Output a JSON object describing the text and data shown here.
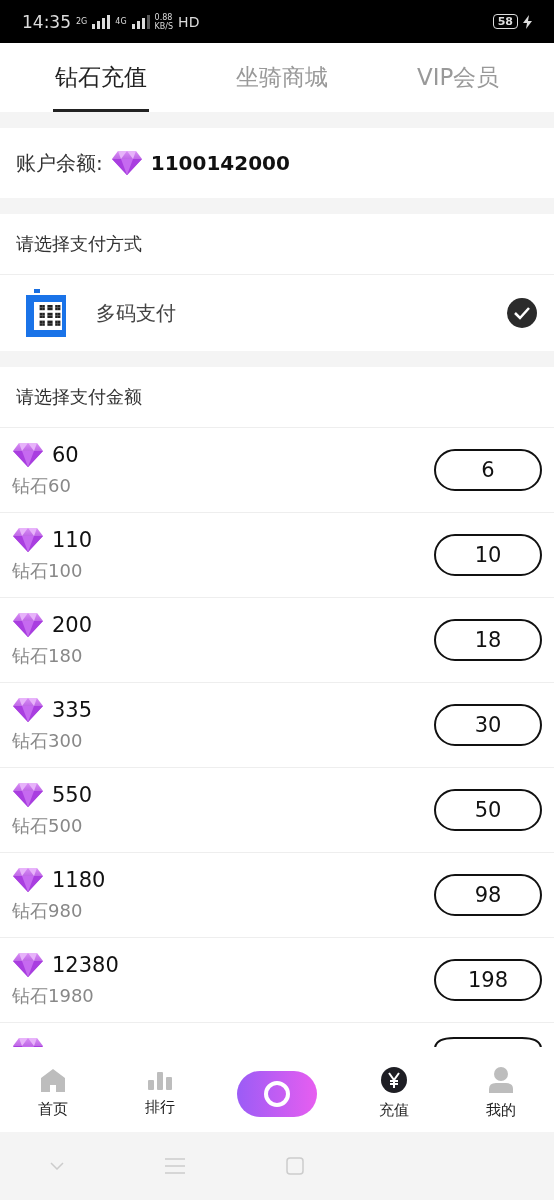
{
  "status_bar": {
    "time": "14:35",
    "net1": "2G",
    "net2": "4G",
    "speed": "0.88",
    "speed_unit": "KB/S",
    "hd": "HD",
    "battery": "58",
    "charging": true
  },
  "tabs": [
    {
      "label": "钻石充值",
      "selected": true
    },
    {
      "label": "坐骑商城",
      "selected": false
    },
    {
      "label": "VIP会员",
      "selected": false
    }
  ],
  "balance": {
    "label": "账户余额:",
    "value": "1100142000"
  },
  "payment": {
    "heading": "请选择支付方式",
    "methods": [
      {
        "name": "多码支付",
        "selected": true
      }
    ]
  },
  "packages": {
    "heading": "请选择支付金额",
    "items": [
      {
        "diamonds": "60",
        "desc": "钻石60",
        "price": "6"
      },
      {
        "diamonds": "110",
        "desc": "钻石100",
        "price": "10"
      },
      {
        "diamonds": "200",
        "desc": "钻石180",
        "price": "18"
      },
      {
        "diamonds": "335",
        "desc": "钻石300",
        "price": "30"
      },
      {
        "diamonds": "550",
        "desc": "钻石500",
        "price": "50"
      },
      {
        "diamonds": "1180",
        "desc": "钻石980",
        "price": "98"
      },
      {
        "diamonds": "12380",
        "desc": "钻石1980",
        "price": "198"
      }
    ],
    "more_below": true
  },
  "bottom_nav": [
    {
      "kind": "home",
      "label": "首页",
      "selected": false
    },
    {
      "kind": "rank",
      "label": "排行",
      "selected": false
    },
    {
      "kind": "live",
      "selected": false
    },
    {
      "kind": "recharge",
      "label": "充值",
      "selected": true
    },
    {
      "kind": "me",
      "label": "我的",
      "selected": false
    }
  ]
}
